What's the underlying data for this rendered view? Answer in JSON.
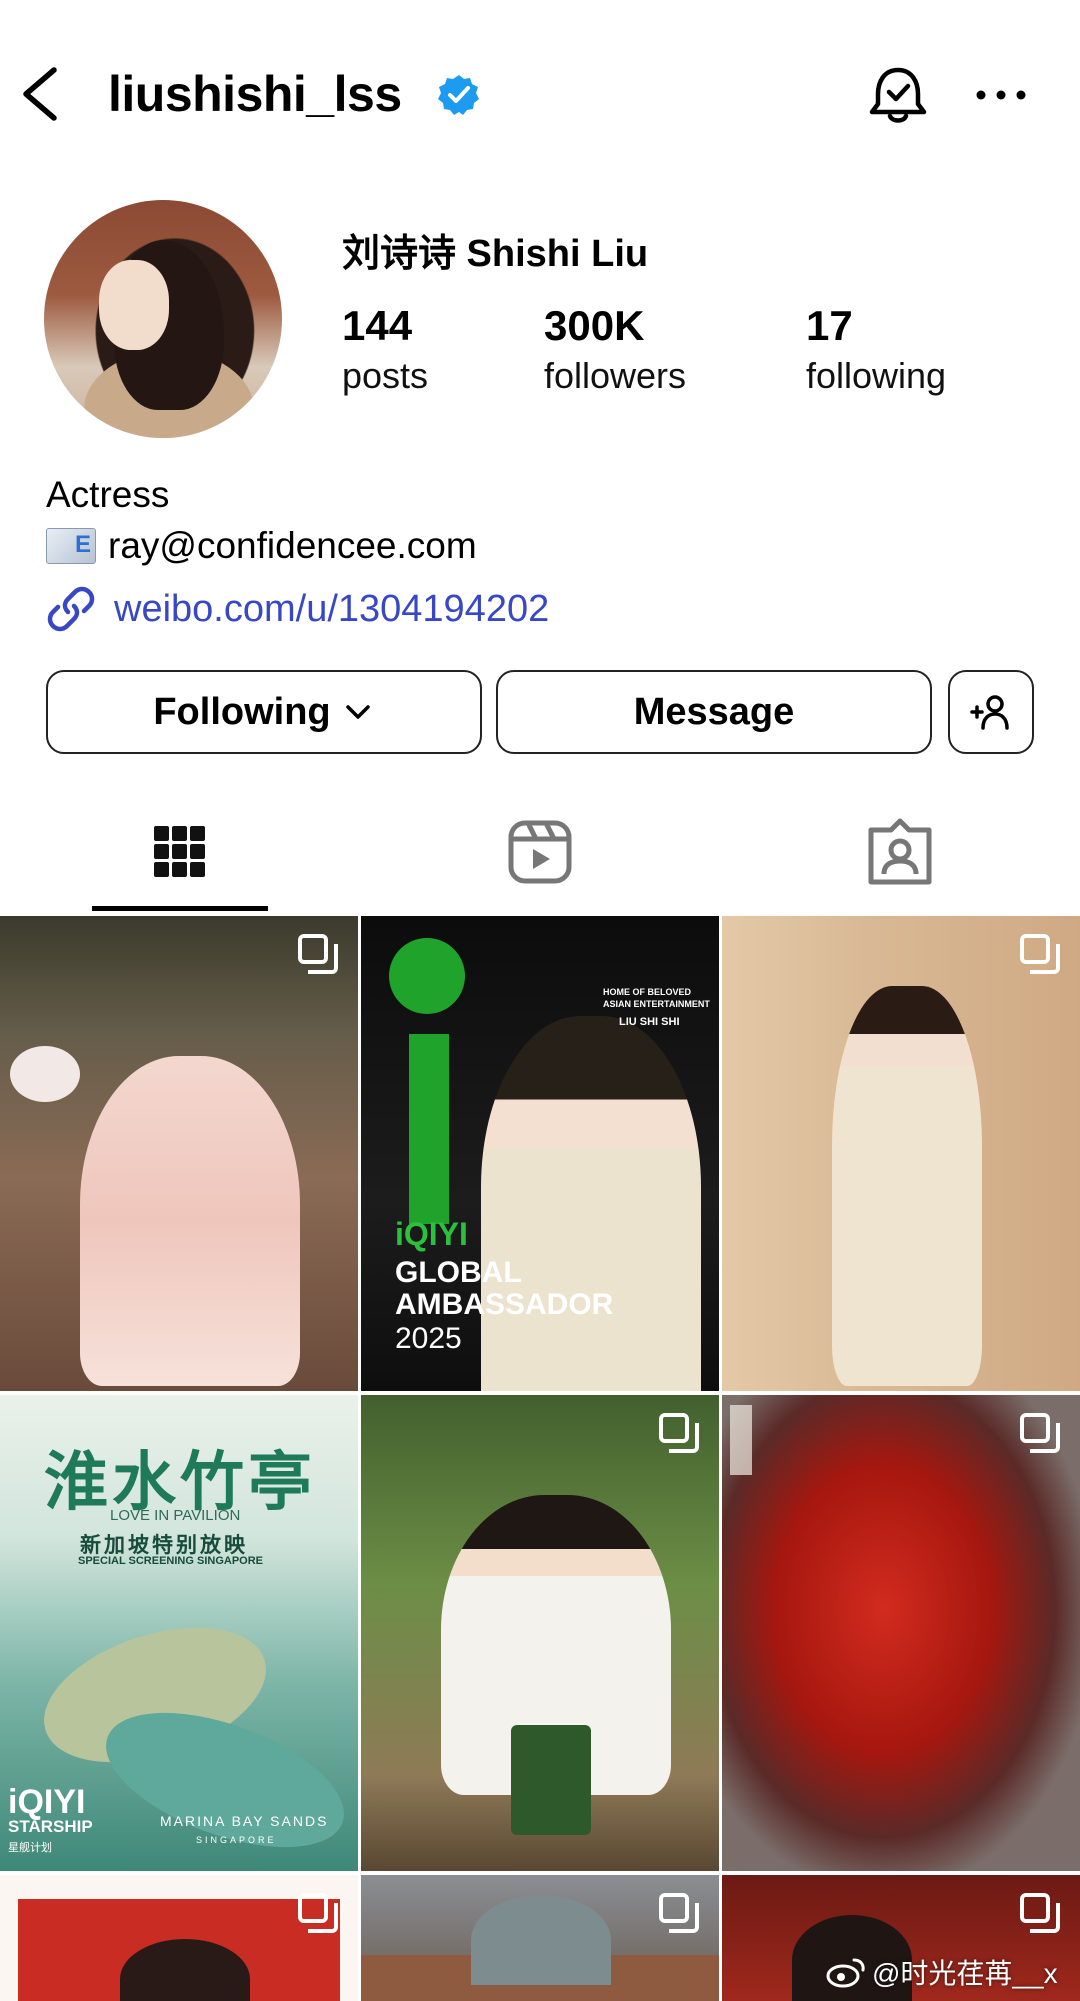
{
  "header": {
    "username": "liushishi_lss",
    "verified": true,
    "icons": [
      "back-arrow-icon",
      "verified-badge-icon",
      "notification-bell-icon",
      "more-options-icon"
    ]
  },
  "profile": {
    "full_name": "刘诗诗 Shishi Liu",
    "stats": {
      "posts_count": "144",
      "posts_label": "posts",
      "followers_count": "300K",
      "followers_label": "followers",
      "following_count": "17",
      "following_label": "following"
    },
    "bio": "Actress",
    "email": "ray@confidencee.com",
    "email_icon_letter": "E",
    "link": "weibo.com/u/1304194202"
  },
  "actions": {
    "following_label": "Following",
    "message_label": "Message"
  },
  "tabs": [
    "grid-icon",
    "reels-icon",
    "tagged-icon"
  ],
  "posts": {
    "p2": {
      "home": "HOME OF BELOVED ASIAN ENTERTAINMENT",
      "name": "LIU SHI SHI",
      "brand": "iQIYI",
      "line1": "GLOBAL",
      "line2": "AMBASSADOR",
      "year": "2025"
    },
    "p4": {
      "title": "淮水竹亭",
      "subtitle_en": "LOVE IN PAVILION",
      "subtitle_cn": "新加坡特别放映",
      "screening": "SPECIAL SCREENING SINGAPORE",
      "brand": "iQIYI",
      "brand2": "STARSHIP",
      "brand3": "星舰计划",
      "venue": "MARINA BAY SANDS",
      "venue_sub": "SINGAPORE"
    }
  },
  "watermark": "@时光荏苒__x",
  "colors": {
    "link": "#3847c6",
    "verified": "#1d9bf0",
    "iqiyi_green": "#1fa32b"
  }
}
